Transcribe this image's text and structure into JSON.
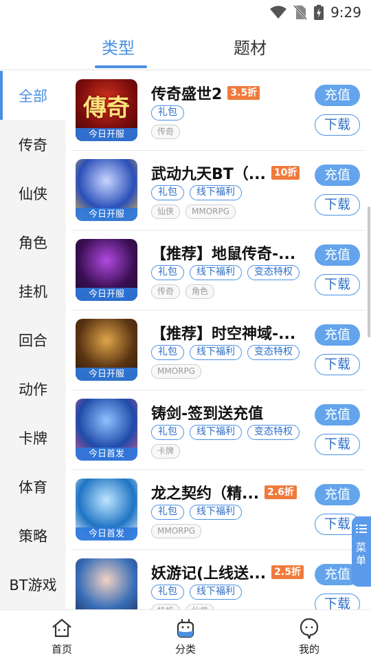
{
  "status": {
    "time": "9:29"
  },
  "top_tabs": [
    {
      "label": "类型",
      "active": true
    },
    {
      "label": "题材",
      "active": false
    }
  ],
  "sidebar": {
    "items": [
      {
        "label": "全部",
        "active": true
      },
      {
        "label": "传奇"
      },
      {
        "label": "仙侠"
      },
      {
        "label": "角色"
      },
      {
        "label": "挂机"
      },
      {
        "label": "回合"
      },
      {
        "label": "动作"
      },
      {
        "label": "卡牌"
      },
      {
        "label": "体育"
      },
      {
        "label": "策略"
      },
      {
        "label": "BT游戏"
      }
    ]
  },
  "actions": {
    "recharge": "充值",
    "download": "下载"
  },
  "games": [
    {
      "title": "传奇盛世2",
      "discount": "3.5折",
      "badge": "今日开服",
      "benefits": [
        "礼包"
      ],
      "tags": [
        "传奇"
      ],
      "thumb_glyph": "傳奇",
      "thumb_colors": [
        "#7a0d0d",
        "#d9341f",
        "#3a0505"
      ]
    },
    {
      "title": "武动九天BT（...",
      "discount": "10折",
      "badge": "今日开服",
      "benefits": [
        "礼包",
        "线下福利"
      ],
      "tags": [
        "仙侠",
        "MMORPG"
      ],
      "thumb_glyph": "",
      "thumb_colors": [
        "#2a4fb8",
        "#c9d6ff",
        "#f0c24a"
      ]
    },
    {
      "title": "【推荐】地鼠传奇-...",
      "discount": "",
      "badge": "今日开服",
      "benefits": [
        "礼包",
        "线下福利",
        "变态特权"
      ],
      "tags": [
        "传奇",
        "角色"
      ],
      "thumb_glyph": "",
      "thumb_colors": [
        "#3b0f54",
        "#b04ae0",
        "#1b0a22"
      ]
    },
    {
      "title": "【推荐】时空神域-...",
      "discount": "",
      "badge": "今日开服",
      "benefits": [
        "礼包",
        "线下福利",
        "变态特权"
      ],
      "tags": [
        "MMORPG"
      ],
      "thumb_glyph": "",
      "thumb_colors": [
        "#5a3412",
        "#e0a54a",
        "#2a1606"
      ]
    },
    {
      "title": "铸剑-签到送充值",
      "discount": "",
      "badge": "今日首发",
      "benefits": [
        "礼包",
        "线下福利",
        "变态特权"
      ],
      "tags": [
        "卡牌"
      ],
      "thumb_glyph": "",
      "thumb_colors": [
        "#1f4aa8",
        "#8fc1ff",
        "#e35a8a"
      ]
    },
    {
      "title": "龙之契约（精...",
      "discount": "2.6折",
      "badge": "今日首发",
      "benefits": [
        "礼包",
        "线下福利"
      ],
      "tags": [
        "MMORPG"
      ],
      "thumb_glyph": "",
      "thumb_colors": [
        "#1e74c4",
        "#bfe6ff",
        "#ffffff"
      ]
    },
    {
      "title": "妖游记(上线送...",
      "discount": "2.5折",
      "badge": "",
      "benefits": [
        "礼包",
        "线下福利"
      ],
      "tags": [
        "挂机",
        "仙侠"
      ],
      "thumb_glyph": "",
      "thumb_colors": [
        "#3a6fb8",
        "#f3d2c2",
        "#1a2c5a"
      ]
    }
  ],
  "float_menu": {
    "label": "菜单"
  },
  "bottom_nav": [
    {
      "label": "首页",
      "icon": "home-icon"
    },
    {
      "label": "分类",
      "icon": "category-icon",
      "active": true
    },
    {
      "label": "我的",
      "icon": "profile-icon"
    }
  ],
  "colors": {
    "accent": "#4a90e2",
    "discount": "#f07a3c"
  }
}
